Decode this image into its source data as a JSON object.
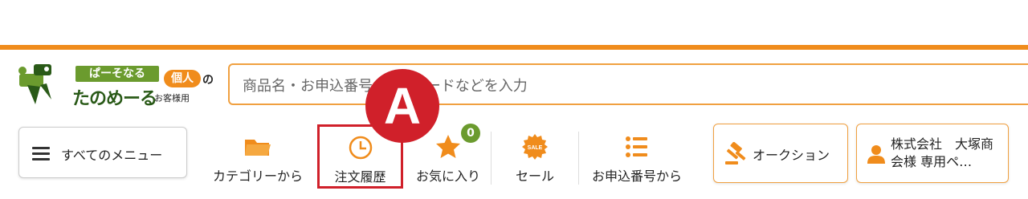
{
  "colors": {
    "accent": "#f08c1c",
    "brand_green": "#6b9b2e",
    "annotation_red": "#d0202a"
  },
  "logo": {
    "brand_top": "ぱーそなる",
    "brand_main": "たのめーる",
    "badge_personal": "個人",
    "suffix": "の",
    "sub": "お客様用"
  },
  "search": {
    "placeholder": "商品名・お申込番号・JANコードなどを入力",
    "value": ""
  },
  "menu_button": {
    "label": "すべてのメニュー"
  },
  "nav": {
    "category": {
      "label": "カテゴリーから",
      "icon": "folder-icon"
    },
    "history": {
      "label": "注文履歴",
      "icon": "clock-icon"
    },
    "favorites": {
      "label": "お気に入り",
      "icon": "star-icon",
      "count": "0"
    },
    "sale": {
      "label": "セール",
      "icon": "sale-badge-icon",
      "badge_text": "SALE"
    },
    "order_number": {
      "label": "お申込番号から",
      "icon": "list-icon"
    }
  },
  "auction": {
    "label": "オークション",
    "icon": "gavel-icon"
  },
  "account": {
    "label": "株式会社　大塚商会様 専用ペ…",
    "icon": "user-icon"
  },
  "annotation": {
    "label": "A"
  }
}
